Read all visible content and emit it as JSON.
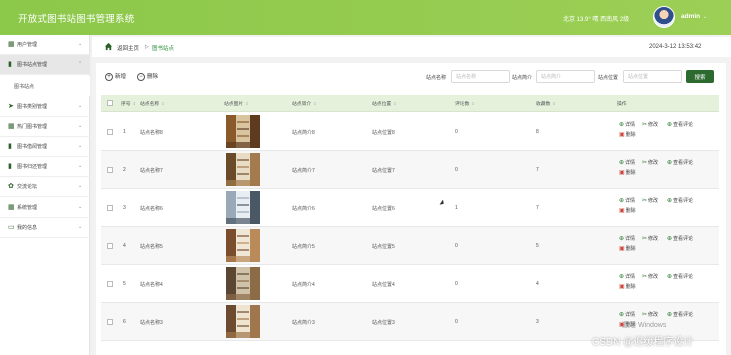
{
  "header": {
    "app_title": "开放式图书站图书管理系统",
    "weather": "北京  13.9°  晴  西南风  2级",
    "username": "admin",
    "caret": "⌄"
  },
  "sidebar": {
    "items": [
      {
        "label": "用户管理",
        "icon": "grid-icon",
        "glyph": "▦",
        "caret": "⌄"
      },
      {
        "label": "图书站点管理",
        "icon": "bar-chart-icon",
        "glyph": "▮",
        "caret": "⌃"
      },
      {
        "label": "图书类别管理",
        "icon": "send-icon",
        "glyph": "➤",
        "caret": "⌄"
      },
      {
        "label": "热门图书管理",
        "icon": "grid-icon",
        "glyph": "▦",
        "caret": "⌄"
      },
      {
        "label": "图书借阅管理",
        "icon": "book-icon",
        "glyph": "▮",
        "caret": "⌄"
      },
      {
        "label": "图书归还管理",
        "icon": "bar-chart-icon",
        "glyph": "▮",
        "caret": "⌄"
      },
      {
        "label": "交流论坛",
        "icon": "palette-icon",
        "glyph": "✿",
        "caret": "⌄"
      },
      {
        "label": "系统管理",
        "icon": "grid-icon",
        "glyph": "▦",
        "caret": "⌄"
      },
      {
        "label": "我的信息",
        "icon": "id-card-icon",
        "glyph": "▭",
        "caret": "⌄"
      }
    ],
    "sub_item": "图书站点"
  },
  "breadcrumb": {
    "home": "返回主页",
    "separator": "▷",
    "current": "图书站点"
  },
  "datetime": "2024-3-12 13:53:42",
  "toolbar": {
    "add_label": "新增",
    "delete_label": "删除",
    "search_fields": [
      {
        "label": "站点名称",
        "placeholder": "站点名称"
      },
      {
        "label": "站点简介",
        "placeholder": "站点简介"
      },
      {
        "label": "站点位置",
        "placeholder": "站点位置"
      }
    ],
    "search_label": "搜索"
  },
  "table": {
    "columns": [
      "",
      "序号",
      "站点名称",
      "站点图片",
      "站点简介",
      "站点位置",
      "评论数",
      "收藏数",
      "操作"
    ],
    "sort_glyph": "⇕",
    "actions": {
      "detail": "详情",
      "edit": "修改",
      "reviews": "查看评论",
      "delete": "删除"
    },
    "rows": [
      {
        "index": "1",
        "name": "站点名称8",
        "intro": "站点简介8",
        "location": "站点位置8",
        "comments": "0",
        "favorites": "8"
      },
      {
        "index": "2",
        "name": "站点名称7",
        "intro": "站点简介7",
        "location": "站点位置7",
        "comments": "0",
        "favorites": "7"
      },
      {
        "index": "3",
        "name": "站点名称6",
        "intro": "站点简介6",
        "location": "站点位置6",
        "comments": "1",
        "favorites": "7"
      },
      {
        "index": "4",
        "name": "站点名称5",
        "intro": "站点简介5",
        "location": "站点位置5",
        "comments": "0",
        "favorites": "5"
      },
      {
        "index": "5",
        "name": "站点名称4",
        "intro": "站点简介4",
        "location": "站点位置4",
        "comments": "0",
        "favorites": "4"
      },
      {
        "index": "6",
        "name": "站点名称3",
        "intro": "站点简介3",
        "location": "站点位置3",
        "comments": "0",
        "favorites": "3"
      }
    ]
  },
  "overlay": {
    "watermark": "CSDN @迟缓程序设计",
    "windows_mark": "激活 Windows"
  },
  "colors": {
    "header_green": "#8cc84a",
    "accent_green": "#2d6a2f",
    "table_head": "#e6f1dc",
    "delete_red": "#d0453b"
  }
}
